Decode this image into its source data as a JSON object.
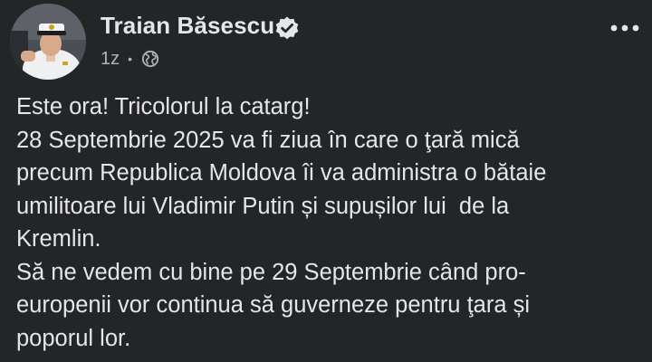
{
  "post": {
    "author": "Traian Băsescu",
    "verified": true,
    "timestamp": "1z",
    "audience_icon": "globe-icon",
    "more_icon": "more-options-icon",
    "lines": [
      "Este ora! Tricolorul la catarg!",
      "28 Septembrie 2025 va fi ziua în care o ţară mică",
      "precum Republica Moldova îi va administra o bătaie",
      "umilitoare lui Vladimir Putin și supușilor lui  de la",
      "Kremlin.",
      "Să ne vedem cu bine pe 29 Septembrie când pro-",
      "europenii vor continua să guverneze pentru ţara și",
      "poporul lor."
    ]
  },
  "colors": {
    "background": "#242526",
    "primary_text": "#e4e6eb",
    "secondary_text": "#b0b3b8"
  }
}
